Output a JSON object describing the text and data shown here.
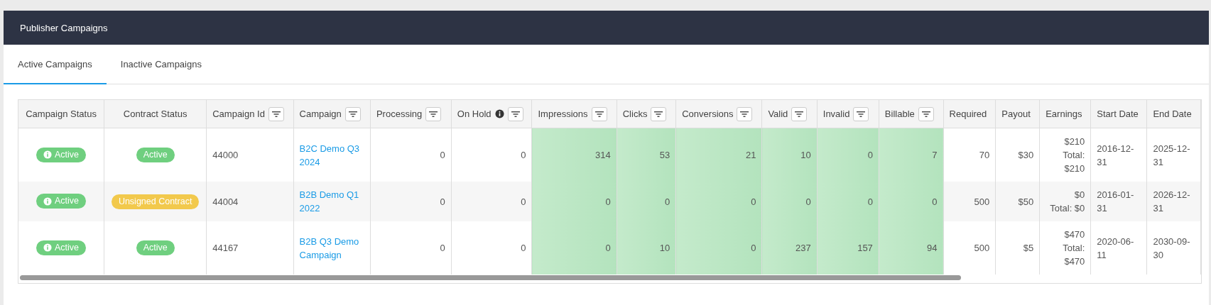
{
  "panel": {
    "title": "Publisher Campaigns"
  },
  "tabs": [
    {
      "label": "Active Campaigns",
      "selected": true
    },
    {
      "label": "Inactive Campaigns",
      "selected": false
    }
  ],
  "table": {
    "columns": [
      {
        "label": "Campaign Status",
        "kind": "status",
        "filter": false,
        "info": false,
        "highlight": false
      },
      {
        "label": "Contract Status",
        "kind": "contract",
        "filter": false,
        "info": false,
        "highlight": false
      },
      {
        "label": "Campaign Id",
        "kind": "text",
        "filter": true,
        "info": false,
        "highlight": false
      },
      {
        "label": "Campaign",
        "kind": "link",
        "filter": true,
        "info": false,
        "highlight": false
      },
      {
        "label": "Processing",
        "kind": "number",
        "filter": true,
        "info": false,
        "highlight": false
      },
      {
        "label": "On Hold",
        "kind": "number",
        "filter": true,
        "info": true,
        "highlight": false
      },
      {
        "label": "Impressions",
        "kind": "number",
        "filter": true,
        "info": false,
        "highlight": true
      },
      {
        "label": "Clicks",
        "kind": "number",
        "filter": true,
        "info": false,
        "highlight": true
      },
      {
        "label": "Conversions",
        "kind": "number",
        "filter": true,
        "info": false,
        "highlight": true
      },
      {
        "label": "Valid",
        "kind": "number",
        "filter": true,
        "info": false,
        "highlight": true
      },
      {
        "label": "Invalid",
        "kind": "number",
        "filter": true,
        "info": false,
        "highlight": true
      },
      {
        "label": "Billable",
        "kind": "number",
        "filter": true,
        "info": false,
        "highlight": true
      },
      {
        "label": "Required",
        "kind": "number",
        "filter": false,
        "info": false,
        "highlight": false
      },
      {
        "label": "Payout",
        "kind": "number",
        "filter": false,
        "info": false,
        "highlight": false
      },
      {
        "label": "Earnings",
        "kind": "earnings",
        "filter": false,
        "info": false,
        "highlight": false
      },
      {
        "label": "Start Date",
        "kind": "text",
        "filter": false,
        "info": false,
        "highlight": false
      },
      {
        "label": "End Date",
        "kind": "text",
        "filter": false,
        "info": false,
        "highlight": false
      }
    ],
    "rows": [
      {
        "cells": [
          {
            "label": "Active",
            "color": "#6fcf7f"
          },
          {
            "label": "Active",
            "color": "#6fcf7f"
          },
          "44000",
          "B2C Demo Q3 2024",
          "0",
          "0",
          "314",
          "53",
          "21",
          "10",
          "0",
          "7",
          "70",
          "$30",
          {
            "amount": "$210",
            "total": "Total: $210"
          },
          "2016-12-31",
          "2025-12-31"
        ]
      },
      {
        "cells": [
          {
            "label": "Active",
            "color": "#6fcf7f"
          },
          {
            "label": "Unsigned Contract",
            "color": "#f2c94c"
          },
          "44004",
          "B2B Demo Q1 2022",
          "0",
          "0",
          "0",
          "0",
          "0",
          "0",
          "0",
          "0",
          "500",
          "$50",
          {
            "amount": "$0",
            "total": "Total: $0"
          },
          "2016-01-31",
          "2026-12-31"
        ]
      },
      {
        "cells": [
          {
            "label": "Active",
            "color": "#6fcf7f"
          },
          {
            "label": "Active",
            "color": "#6fcf7f"
          },
          "44167",
          "B2B Q3 Demo Campaign",
          "0",
          "0",
          "0",
          "10",
          "0",
          "237",
          "157",
          "94",
          "500",
          "$5",
          {
            "amount": "$470",
            "total": "Total: $470"
          },
          "2020-06-11",
          "2030-09-30"
        ]
      }
    ]
  }
}
